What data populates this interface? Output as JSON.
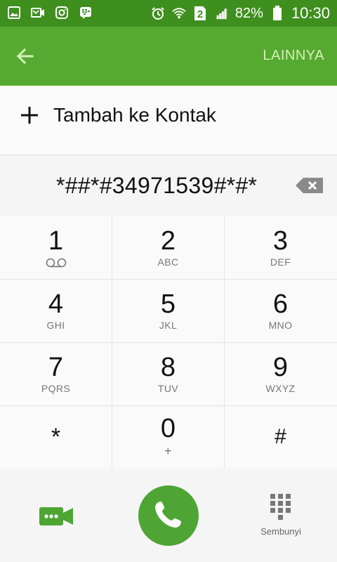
{
  "status_bar": {
    "battery_percent": "82%",
    "time": "10:30",
    "sim_slot": "2",
    "icons": [
      "gallery-icon",
      "missed-video-icon",
      "instagram-icon",
      "bbm-icon",
      "alarm-icon",
      "wifi-icon",
      "sim2-icon",
      "signal-icon",
      "battery-icon"
    ]
  },
  "app_bar": {
    "more_label": "LAINNYA",
    "accent_color": "#57aa31"
  },
  "add_contact": {
    "label": "Tambah ke Kontak"
  },
  "dialer": {
    "number": "*##*#34971539#*#*"
  },
  "keypad": {
    "keys": [
      {
        "digit": "1",
        "letters": ""
      },
      {
        "digit": "2",
        "letters": "ABC"
      },
      {
        "digit": "3",
        "letters": "DEF"
      },
      {
        "digit": "4",
        "letters": "GHI"
      },
      {
        "digit": "5",
        "letters": "JKL"
      },
      {
        "digit": "6",
        "letters": "MNO"
      },
      {
        "digit": "7",
        "letters": "PQRS"
      },
      {
        "digit": "8",
        "letters": "TUV"
      },
      {
        "digit": "9",
        "letters": "WXYZ"
      },
      {
        "digit": "*",
        "letters": ""
      },
      {
        "digit": "0",
        "letters": "+"
      },
      {
        "digit": "#",
        "letters": ""
      }
    ]
  },
  "bottom": {
    "hide_label": "Sembunyi"
  }
}
